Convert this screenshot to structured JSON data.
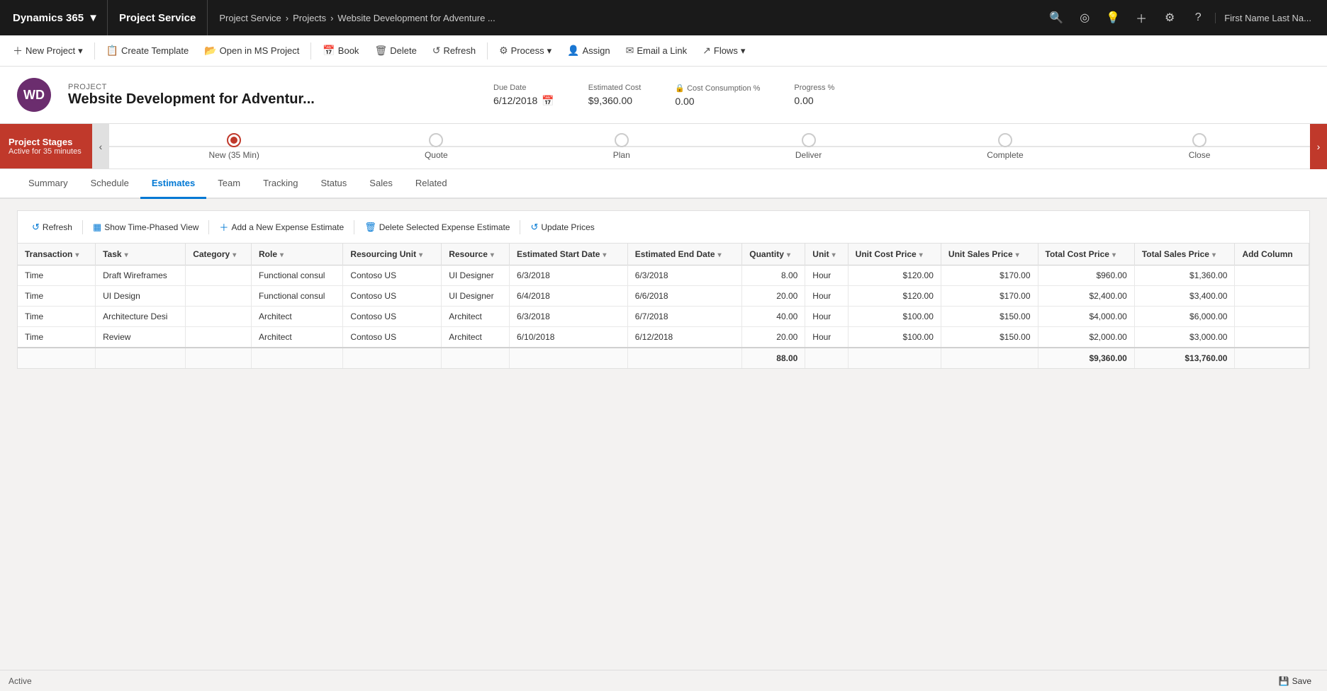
{
  "topNav": {
    "brand": "Dynamics 365",
    "brandChevron": "▼",
    "module": "Project Service",
    "breadcrumb": [
      "Project Service",
      "Projects",
      "Website Development for Adventure ..."
    ],
    "breadcrumbSep": "›",
    "icons": [
      "🔍",
      "◎",
      "💡",
      "＋",
      "⚙",
      "?"
    ],
    "user": "First Name Last Na..."
  },
  "commandBar": {
    "buttons": [
      {
        "label": "New Project",
        "icon": "＋",
        "hasDropdown": true
      },
      {
        "label": "Create Template",
        "icon": "📋",
        "hasDropdown": false
      },
      {
        "label": "Open in MS Project",
        "icon": "📂",
        "hasDropdown": false
      },
      {
        "label": "Book",
        "icon": "📅",
        "hasDropdown": false
      },
      {
        "label": "Delete",
        "icon": "🗑",
        "hasDropdown": false
      },
      {
        "label": "Refresh",
        "icon": "↺",
        "hasDropdown": false
      },
      {
        "label": "Process",
        "icon": "⚙",
        "hasDropdown": true
      },
      {
        "label": "Assign",
        "icon": "👤",
        "hasDropdown": false
      },
      {
        "label": "Email a Link",
        "icon": "✉",
        "hasDropdown": false
      },
      {
        "label": "Flows",
        "icon": "↗",
        "hasDropdown": true
      }
    ]
  },
  "project": {
    "iconText": "WD",
    "labelText": "PROJECT",
    "name": "Website Development for Adventur...",
    "dueDateLabel": "Due Date",
    "dueDate": "6/12/2018",
    "estimatedCostLabel": "Estimated Cost",
    "estimatedCost": "$9,360.00",
    "costConsumptionLabel": "Cost Consumption %",
    "costConsumption": "0.00",
    "progressLabel": "Progress %",
    "progress": "0.00"
  },
  "stages": {
    "boxTitle": "Project Stages",
    "boxSubtitle": "Active for 35 minutes",
    "items": [
      {
        "label": "New  (35 Min)",
        "active": true
      },
      {
        "label": "Quote",
        "active": false
      },
      {
        "label": "Plan",
        "active": false
      },
      {
        "label": "Deliver",
        "active": false
      },
      {
        "label": "Complete",
        "active": false
      },
      {
        "label": "Close",
        "active": false
      }
    ]
  },
  "tabs": {
    "items": [
      "Summary",
      "Schedule",
      "Estimates",
      "Team",
      "Tracking",
      "Status",
      "Sales",
      "Related"
    ],
    "active": "Estimates"
  },
  "gridToolbar": {
    "buttons": [
      {
        "label": "Refresh",
        "icon": "↺"
      },
      {
        "label": "Show Time-Phased View",
        "icon": "▦"
      },
      {
        "label": "Add a New Expense Estimate",
        "icon": "＋"
      },
      {
        "label": "Delete Selected Expense Estimate",
        "icon": "🗑"
      },
      {
        "label": "Update Prices",
        "icon": "↺"
      }
    ]
  },
  "table": {
    "columns": [
      "Transaction",
      "Task",
      "Category",
      "Role",
      "Resourcing Unit",
      "Resource",
      "Estimated Start Date",
      "Estimated End Date",
      "Quantity",
      "Unit",
      "Unit Cost Price",
      "Unit Sales Price",
      "Total Cost Price",
      "Total Sales Price",
      "Add Column"
    ],
    "rows": [
      {
        "transaction": "Time",
        "task": "Draft Wireframes",
        "category": "",
        "role": "Functional consul",
        "resourcingUnit": "Contoso US",
        "resource": "UI Designer",
        "startDate": "6/3/2018",
        "endDate": "6/3/2018",
        "quantity": "8.00",
        "unit": "Hour",
        "unitCostPrice": "$120.00",
        "unitSalesPrice": "$170.00",
        "totalCostPrice": "$960.00",
        "totalSalesPrice": "$1,360.00"
      },
      {
        "transaction": "Time",
        "task": "UI Design",
        "category": "",
        "role": "Functional consul",
        "resourcingUnit": "Contoso US",
        "resource": "UI Designer",
        "startDate": "6/4/2018",
        "endDate": "6/6/2018",
        "quantity": "20.00",
        "unit": "Hour",
        "unitCostPrice": "$120.00",
        "unitSalesPrice": "$170.00",
        "totalCostPrice": "$2,400.00",
        "totalSalesPrice": "$3,400.00"
      },
      {
        "transaction": "Time",
        "task": "Architecture Desi",
        "category": "",
        "role": "Architect",
        "resourcingUnit": "Contoso US",
        "resource": "Architect",
        "startDate": "6/3/2018",
        "endDate": "6/7/2018",
        "quantity": "40.00",
        "unit": "Hour",
        "unitCostPrice": "$100.00",
        "unitSalesPrice": "$150.00",
        "totalCostPrice": "$4,000.00",
        "totalSalesPrice": "$6,000.00"
      },
      {
        "transaction": "Time",
        "task": "Review",
        "category": "",
        "role": "Architect",
        "resourcingUnit": "Contoso US",
        "resource": "Architect",
        "startDate": "6/10/2018",
        "endDate": "6/12/2018",
        "quantity": "20.00",
        "unit": "Hour",
        "unitCostPrice": "$100.00",
        "unitSalesPrice": "$150.00",
        "totalCostPrice": "$2,000.00",
        "totalSalesPrice": "$3,000.00"
      }
    ],
    "footer": {
      "quantity": "88.00",
      "totalCostPrice": "$9,360.00",
      "totalSalesPrice": "$13,760.00"
    }
  },
  "statusBar": {
    "status": "Active",
    "saveLabel": "Save"
  }
}
